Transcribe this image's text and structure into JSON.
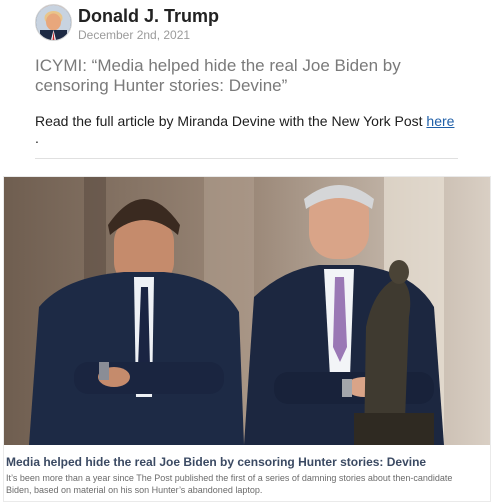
{
  "post": {
    "author": "Donald J. Trump",
    "date": "December 2nd, 2021",
    "headline": "ICYMI: “Media helped hide the real Joe Biden by censoring Hunter stories: Devine”",
    "body_prefix": "Read the full article by Miranda Devine with the New York Post ",
    "link_text": "here",
    "body_suffix": " ."
  },
  "card": {
    "title": "Media helped hide the real Joe Biden by censoring Hunter stories: Devine",
    "description": "It’s been more than a year since The Post published the first of a series of damning stories about then-candidate Biden, based on material on his son Hunter’s abandoned laptop."
  },
  "colors": {
    "author": "#222222",
    "date": "#9b9b9b",
    "headline": "#7a7a7a",
    "link": "#1f5fa8",
    "card_title": "#3b4a63"
  },
  "icons": {
    "avatar": "profile-photo",
    "card_image": "article-photo"
  }
}
